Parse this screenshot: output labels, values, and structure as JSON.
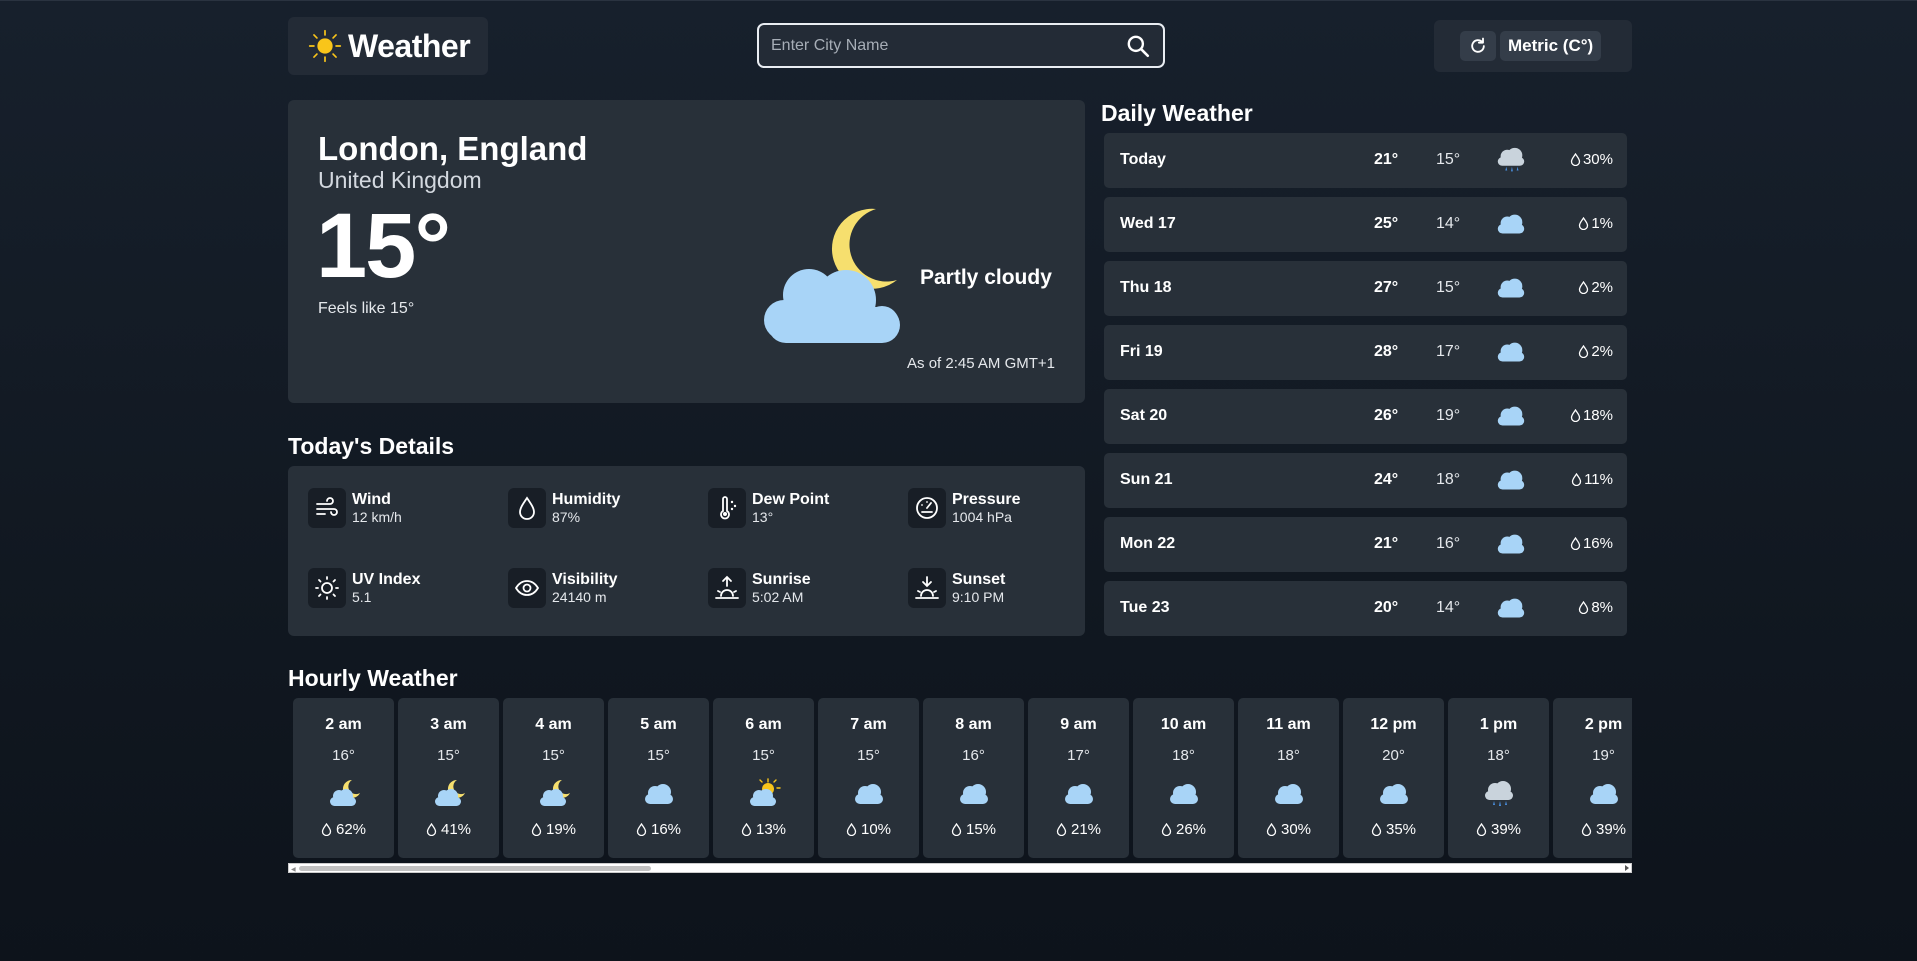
{
  "header": {
    "app_title": "Weather",
    "search_placeholder": "Enter City Name",
    "units_label": "Metric (C°)"
  },
  "current": {
    "city": "London, England",
    "country": "United Kingdom",
    "temperature": "15°",
    "feels_like": "Feels like 15°",
    "condition": "Partly cloudy",
    "as_of": "As of 2:45 AM GMT+1",
    "icon": "moon-cloud-icon"
  },
  "details": {
    "title": "Today's Details",
    "items": [
      {
        "label": "Wind",
        "value": "12 km/h",
        "icon": "wind-icon"
      },
      {
        "label": "Humidity",
        "value": "87%",
        "icon": "humidity-drop-icon"
      },
      {
        "label": "Dew Point",
        "value": "13°",
        "icon": "dew-point-thermometer-icon"
      },
      {
        "label": "Pressure",
        "value": "1004 hPa",
        "icon": "pressure-gauge-icon"
      },
      {
        "label": "UV Index",
        "value": "5.1",
        "icon": "uv-sun-icon"
      },
      {
        "label": "Visibility",
        "value": "24140 m",
        "icon": "visibility-eye-icon"
      },
      {
        "label": "Sunrise",
        "value": "5:02 AM",
        "icon": "sunrise-icon"
      },
      {
        "label": "Sunset",
        "value": "9:10 PM",
        "icon": "sunset-icon"
      }
    ]
  },
  "daily": {
    "title": "Daily Weather",
    "days": [
      {
        "name": "Today",
        "high": "21°",
        "low": "15°",
        "pop": "30%",
        "icon": "rain-cloud-icon"
      },
      {
        "name": "Wed 17",
        "high": "25°",
        "low": "14°",
        "pop": "1%",
        "icon": "cloud-icon"
      },
      {
        "name": "Thu 18",
        "high": "27°",
        "low": "15°",
        "pop": "2%",
        "icon": "cloud-icon"
      },
      {
        "name": "Fri 19",
        "high": "28°",
        "low": "17°",
        "pop": "2%",
        "icon": "cloud-icon"
      },
      {
        "name": "Sat 20",
        "high": "26°",
        "low": "19°",
        "pop": "18%",
        "icon": "cloud-icon"
      },
      {
        "name": "Sun 21",
        "high": "24°",
        "low": "18°",
        "pop": "11%",
        "icon": "cloud-icon"
      },
      {
        "name": "Mon 22",
        "high": "21°",
        "low": "16°",
        "pop": "16%",
        "icon": "cloud-icon"
      },
      {
        "name": "Tue 23",
        "high": "20°",
        "low": "14°",
        "pop": "8%",
        "icon": "cloud-icon"
      }
    ]
  },
  "hourly": {
    "title": "Hourly Weather",
    "hours": [
      {
        "time": "2 am",
        "temp": "16°",
        "pop": "62%",
        "icon": "moon-cloud-icon"
      },
      {
        "time": "3 am",
        "temp": "15°",
        "pop": "41%",
        "icon": "moon-cloud-icon"
      },
      {
        "time": "4 am",
        "temp": "15°",
        "pop": "19%",
        "icon": "moon-cloud-icon"
      },
      {
        "time": "5 am",
        "temp": "15°",
        "pop": "16%",
        "icon": "cloud-icon"
      },
      {
        "time": "6 am",
        "temp": "15°",
        "pop": "13%",
        "icon": "sun-cloud-icon"
      },
      {
        "time": "7 am",
        "temp": "15°",
        "pop": "10%",
        "icon": "cloud-icon"
      },
      {
        "time": "8 am",
        "temp": "16°",
        "pop": "15%",
        "icon": "cloud-icon"
      },
      {
        "time": "9 am",
        "temp": "17°",
        "pop": "21%",
        "icon": "cloud-icon"
      },
      {
        "time": "10 am",
        "temp": "18°",
        "pop": "26%",
        "icon": "cloud-icon"
      },
      {
        "time": "11 am",
        "temp": "18°",
        "pop": "30%",
        "icon": "cloud-icon"
      },
      {
        "time": "12 pm",
        "temp": "20°",
        "pop": "35%",
        "icon": "cloud-icon"
      },
      {
        "time": "1 pm",
        "temp": "18°",
        "pop": "39%",
        "icon": "rain-cloud-icon"
      },
      {
        "time": "2 pm",
        "temp": "19°",
        "pop": "39%",
        "icon": "cloud-icon"
      }
    ]
  },
  "colors": {
    "background": "#111821",
    "card": "#283039",
    "cloud": "#a8d4f7",
    "moon": "#f6df6e",
    "sun": "#f9c51a"
  }
}
